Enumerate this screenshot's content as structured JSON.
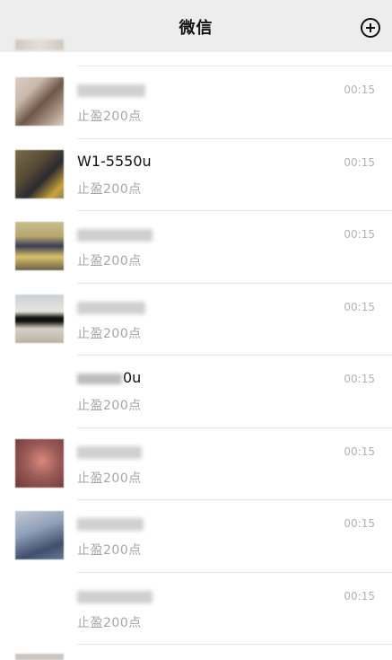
{
  "header": {
    "title": "微信",
    "add_icon": "plus-circle-icon"
  },
  "chats": [
    {
      "name": "",
      "time": "00:15",
      "preview": "止盈200点",
      "avatar": [
        "#d9cfc6",
        "#6e5648",
        "#c8b8aa"
      ]
    },
    {
      "name": "W1-5550u",
      "time": "00:15",
      "preview": "止盈200点",
      "avatar": [
        "#7b6b4d",
        "#2b2b33",
        "#c9a437"
      ]
    },
    {
      "name": "",
      "time": "00:15",
      "preview": "止盈200点",
      "avatar": [
        "#b6a76a",
        "#3a3b55",
        "#d8c268"
      ]
    },
    {
      "name": "",
      "time": "00:15",
      "preview": "止盈200点",
      "avatar": [
        "#c9d0d6",
        "#101010",
        "#e8e4dd"
      ]
    },
    {
      "name": "0u",
      "time": "00:15",
      "preview": "止盈200点",
      "avatar": null
    },
    {
      "name": "",
      "time": "00:15",
      "preview": "止盈200点",
      "avatar": [
        "#9c5a57",
        "#d98a7f",
        "#6b3a3a"
      ]
    },
    {
      "name": "",
      "time": "00:15",
      "preview": "止盈200点",
      "avatar": [
        "#8f9fb7",
        "#3f4f6c",
        "#c3cad6"
      ]
    },
    {
      "name": "",
      "time": "00:15",
      "preview": "止盈200点",
      "avatar": null
    }
  ]
}
